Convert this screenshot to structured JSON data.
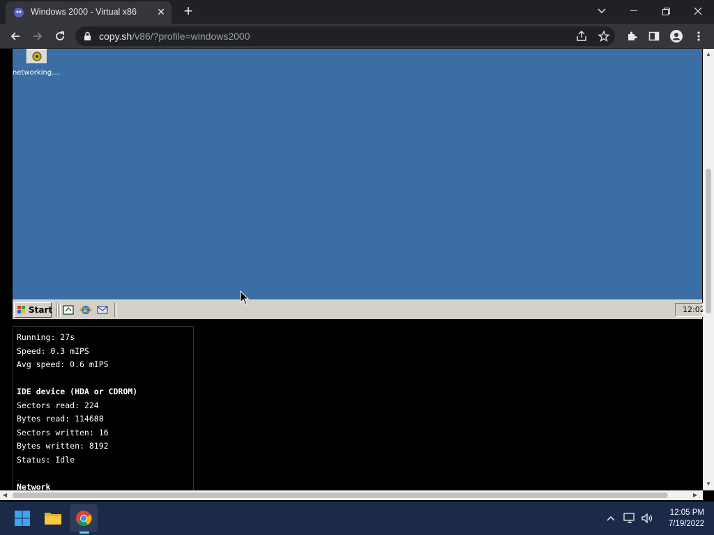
{
  "browser": {
    "tab_title": "Windows 2000 - Virtual x86",
    "url_host": "copy.sh",
    "url_path": "/v86/?profile=windows2000"
  },
  "vm": {
    "desktop_icon_label": "networking....",
    "taskbar": {
      "start_label": "Start",
      "tray_time": "12:02"
    }
  },
  "stats": {
    "running": "Running: 27s",
    "speed": "Speed: 0.3 mIPS",
    "avg_speed": "Avg speed: 0.6 mIPS",
    "ide_header": "IDE device (HDA or CDROM)",
    "sectors_read": "Sectors read: 224",
    "bytes_read": "Bytes read: 114688",
    "sectors_written": "Sectors written: 16",
    "bytes_written": "Bytes written: 8192",
    "status": "Status: Idle",
    "network_header": "Network"
  },
  "os_taskbar": {
    "time": "12:05 PM",
    "date": "7/19/2022"
  },
  "colors": {
    "vm_desktop": "#3a6ea5",
    "chrome_dark": "#202124",
    "w11_taskbar": "#1c2a4a"
  }
}
